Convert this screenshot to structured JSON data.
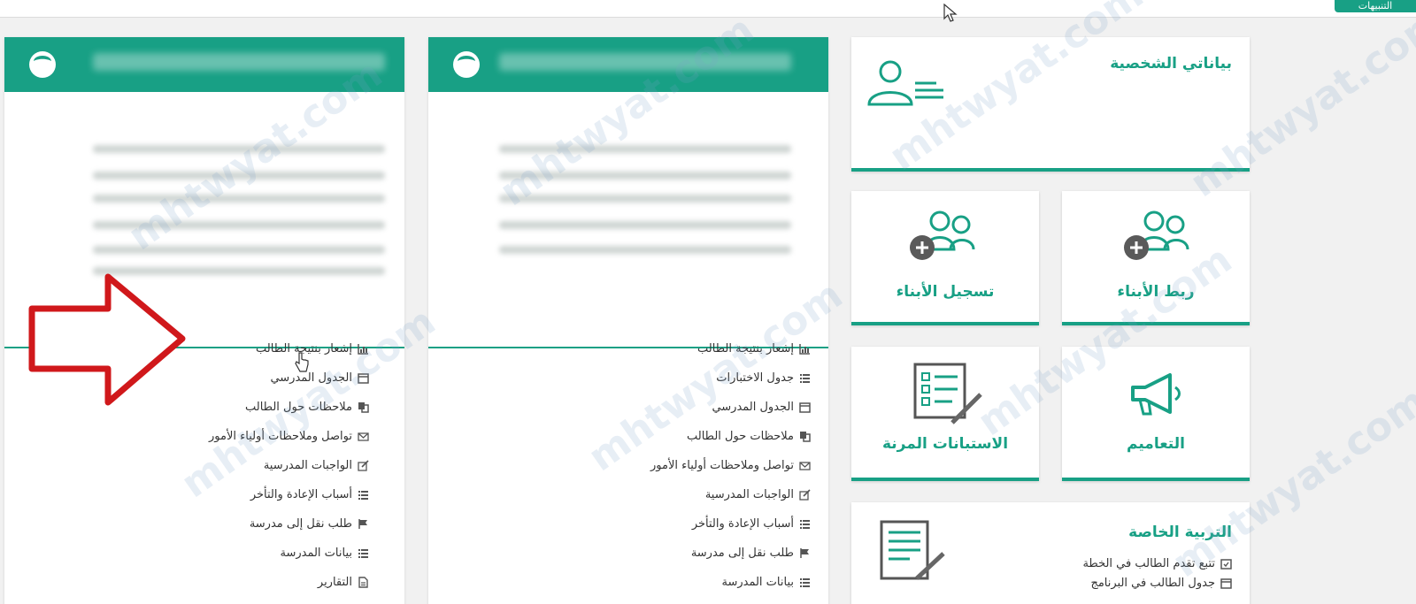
{
  "topbar": {
    "alerts_label": "التنبيهات"
  },
  "colors": {
    "accent": "#18a085",
    "arrow": "#d0181b"
  },
  "cards": {
    "personal": {
      "title": "بياناتي الشخصية",
      "icon": "user-profile-icon"
    },
    "link_children": {
      "title": "ربط الأبناء",
      "icon": "users-add-icon"
    },
    "register_children": {
      "title": "تسجيل الأبناء",
      "icon": "users-add-icon"
    },
    "announcements": {
      "title": "التعاميم",
      "icon": "megaphone-icon"
    },
    "surveys": {
      "title": "الاستبانات المرنة",
      "icon": "survey-form-icon"
    },
    "special_ed": {
      "title": "التربية الخاصة",
      "icon": "document-edit-icon",
      "items": [
        {
          "label": "تتبع تقدم الطالب في الخطة",
          "icon": "calendar-check-icon"
        },
        {
          "label": "جدول الطالب في البرنامج",
          "icon": "calendar-icon"
        }
      ]
    }
  },
  "panel_left": {
    "menu": [
      {
        "label": "إشعار بنتيجة الطالب",
        "icon": "chart-icon"
      },
      {
        "label": "الجدول المدرسي",
        "icon": "calendar-icon"
      },
      {
        "label": "ملاحظات حول الطالب",
        "icon": "copy-icon"
      },
      {
        "label": "تواصل وملاحظات أولياء الأمور",
        "icon": "envelope-icon"
      },
      {
        "label": "الواجبات المدرسية",
        "icon": "edit-icon"
      },
      {
        "label": "أسباب الإعادة والتأخر",
        "icon": "list-icon"
      },
      {
        "label": "طلب نقل إلى مدرسة",
        "icon": "flag-icon"
      },
      {
        "label": "بيانات المدرسة",
        "icon": "list-icon"
      },
      {
        "label": "التقارير",
        "icon": "file-icon"
      }
    ]
  },
  "panel_middle": {
    "menu": [
      {
        "label": "إشعار بنتيجة الطالب",
        "icon": "chart-icon"
      },
      {
        "label": "جدول الاختبارات",
        "icon": "list-icon"
      },
      {
        "label": "الجدول المدرسي",
        "icon": "calendar-icon"
      },
      {
        "label": "ملاحظات حول الطالب",
        "icon": "copy-icon"
      },
      {
        "label": "تواصل وملاحظات أولياء الأمور",
        "icon": "envelope-icon"
      },
      {
        "label": "الواجبات المدرسية",
        "icon": "edit-icon"
      },
      {
        "label": "أسباب الإعادة والتأخر",
        "icon": "list-icon"
      },
      {
        "label": "طلب نقل إلى مدرسة",
        "icon": "flag-icon"
      },
      {
        "label": "بيانات المدرسة",
        "icon": "list-icon"
      }
    ]
  },
  "watermark": "mhtwyat.com"
}
